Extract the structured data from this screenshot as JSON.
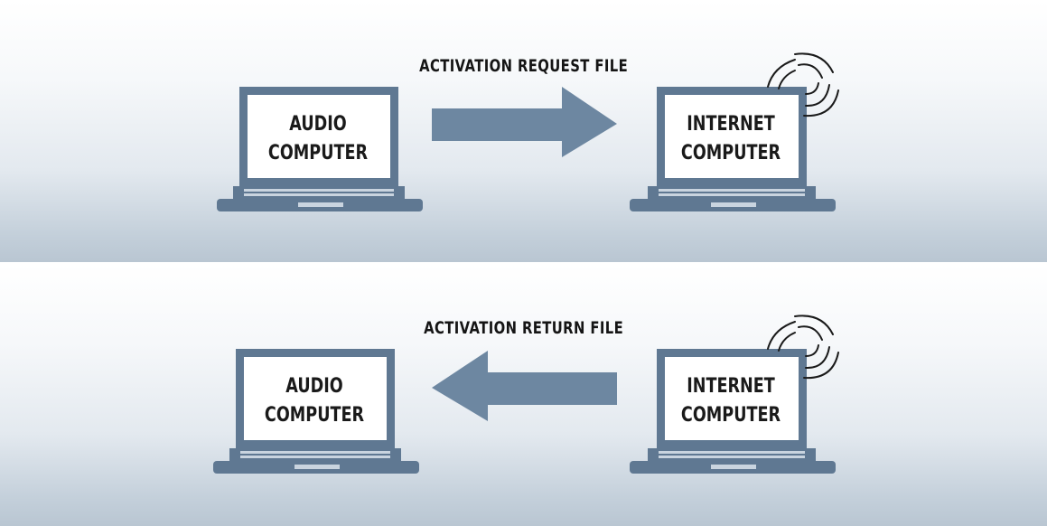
{
  "rows": [
    {
      "label": "ACTIVATION REQUEST FILE",
      "left_computer": {
        "line1": "AUDIO",
        "line2": "COMPUTER"
      },
      "right_computer": {
        "line1": "INTERNET",
        "line2": "COMPUTER"
      },
      "arrow_direction": "right"
    },
    {
      "label": "ACTIVATION RETURN FILE",
      "left_computer": {
        "line1": "AUDIO",
        "line2": "COMPUTER"
      },
      "right_computer": {
        "line1": "INTERNET",
        "line2": "COMPUTER"
      },
      "arrow_direction": "left"
    }
  ],
  "colors": {
    "laptop": "#5f7892",
    "arrow": "#6d87a1",
    "screen": "#ffffff",
    "text": "#1a1a1a"
  },
  "icons": [
    "laptop-icon",
    "arrow-right-icon",
    "arrow-left-icon",
    "wifi-signal-icon"
  ]
}
